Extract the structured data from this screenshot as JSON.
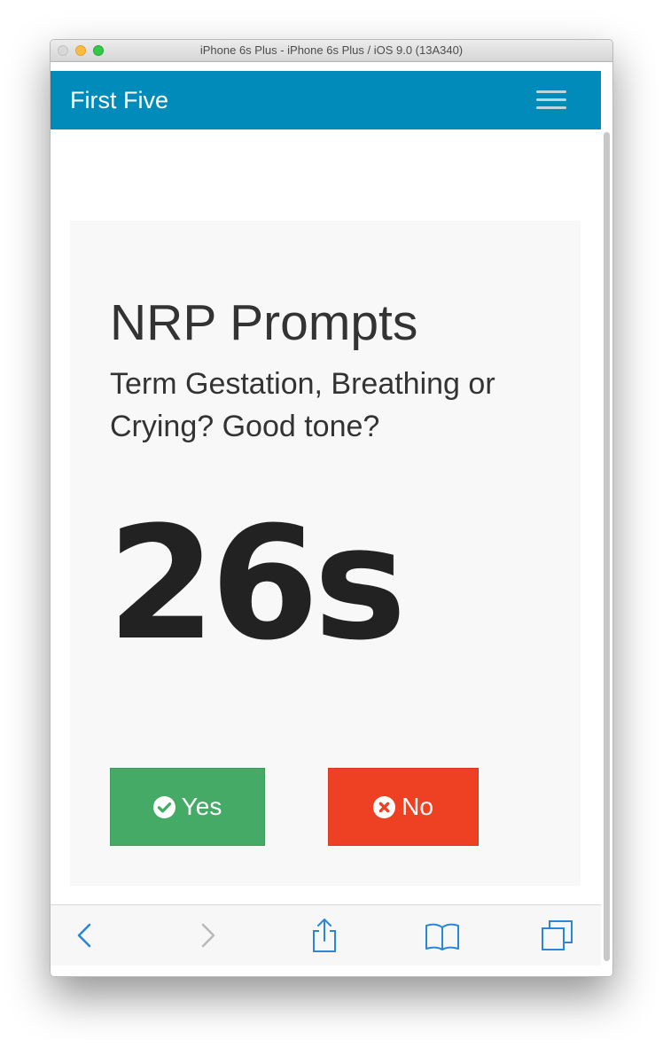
{
  "window": {
    "title": "iPhone 6s Plus - iPhone 6s Plus / iOS 9.0 (13A340)"
  },
  "navbar": {
    "brand": "First Five",
    "menu_icon": "hamburger-menu-icon",
    "color": "#008bba"
  },
  "card": {
    "title": "NRP Prompts",
    "subtitle": "Term Gestation, Breathing or Crying? Good tone?",
    "timer": "26s"
  },
  "buttons": {
    "yes_label": "Yes",
    "yes_icon": "check-circle-icon",
    "yes_color": "#45aa66",
    "no_label": "No",
    "no_icon": "times-circle-icon",
    "no_color": "#ee4022"
  },
  "toolbar": {
    "icons": [
      "back-arrow-icon",
      "forward-arrow-icon",
      "share-icon",
      "bookmarks-icon",
      "tabs-icon"
    ],
    "accent": "#2a86d9"
  }
}
